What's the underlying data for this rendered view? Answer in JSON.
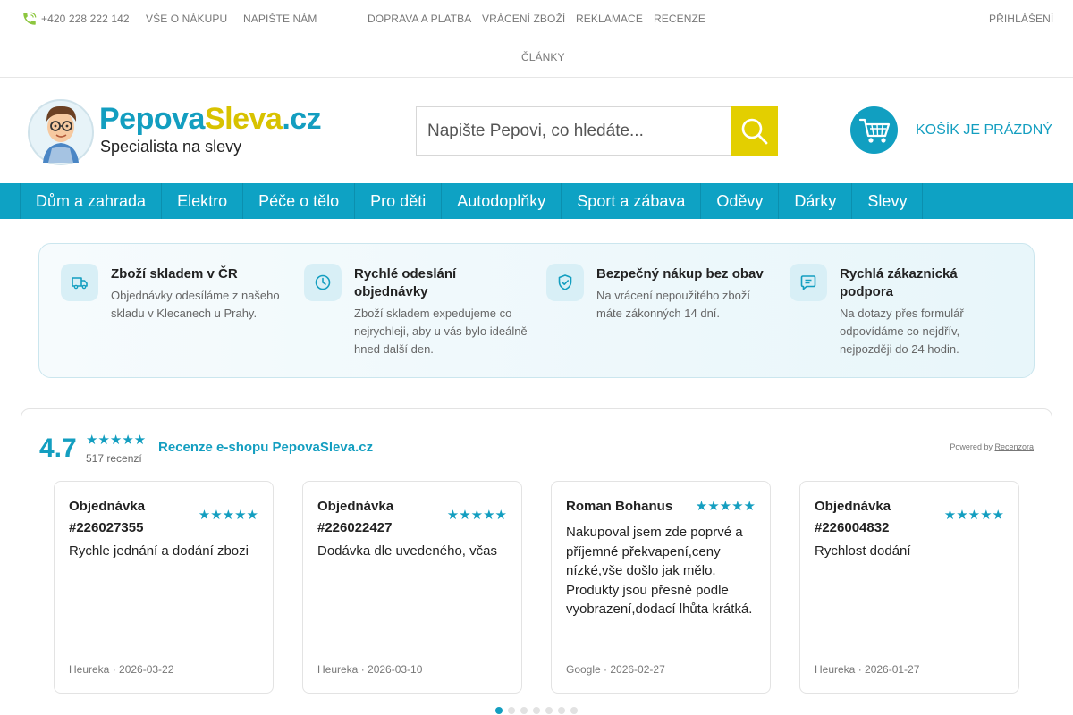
{
  "topbar": {
    "phone": "+420 228 222 142",
    "links": [
      "Vše o nákupu",
      "Napište nám",
      "Doprava a platba",
      "Vrácení zboží",
      "Reklamace",
      "Recenze",
      "Články"
    ],
    "login": "Přihlášení"
  },
  "header": {
    "logo_word1": "Pepova",
    "logo_word2": "Sleva",
    "logo_word3": ".cz",
    "logo_tagline": "Specialista na slevy",
    "search_placeholder": "Napište Pepovi, co hledáte...",
    "cart_label": "KOŠÍK JE PRÁZDNÝ"
  },
  "nav": {
    "items": [
      "Dům a zahrada",
      "Elektro",
      "Péče o tělo",
      "Pro děti",
      "Autodoplňky",
      "Sport a zábava",
      "Oděvy",
      "Dárky",
      "Slevy"
    ]
  },
  "benefits": [
    {
      "icon": "truck-icon",
      "title": "Zboží skladem v ČR",
      "text": "Objednávky odesíláme z našeho skladu v Klecanech u Prahy."
    },
    {
      "icon": "clock-icon",
      "title": "Rychlé odeslání objednávky",
      "text": "Zboží skladem expedujeme co nejrychleji, aby u vás bylo ideálně hned další den."
    },
    {
      "icon": "shield-check-icon",
      "title": "Bezpečný nákup bez obav",
      "text": "Na vrácení nepoužitého zboží máte zákonných 14 dní."
    },
    {
      "icon": "chat-icon",
      "title": "Rychlá zákaznická podpora",
      "text": "Na dotazy přes formulář odpovídáme co nejdřív, nejpozději do 24 hodin."
    }
  ],
  "reviews": {
    "rating": "4.7",
    "stars": "★★★★★",
    "count": "517 recenzí",
    "title": "Recenze e-shopu PepovaSleva.cz",
    "powered_by": "Powered by",
    "powered_link": "Recenzora",
    "items": [
      {
        "author": "Objednávka #226027355",
        "stars": "★★★★★",
        "text": "Rychle jednání a dodání zbozi",
        "source": "Heureka · 2026-03-22"
      },
      {
        "author": "Objednávka #226022427",
        "stars": "★★★★★",
        "text": "Dodávka dle uvedeného, včas",
        "source": "Heureka · 2026-03-10"
      },
      {
        "author": "Roman Bohanus",
        "stars": "★★★★★",
        "text": "Nakupoval jsem zde poprvé a příjemné překvapení,ceny nízké,vše došlo jak mělo. Produkty jsou přesně podle vyobrazení,dodací lhůta krátká.",
        "source": "Google · 2026-02-27"
      },
      {
        "author": "Objednávka #226004832",
        "stars": "★★★★★",
        "text": "Rychlost dodání",
        "source": "Heureka · 2026-01-27"
      }
    ],
    "pagination_count": 7,
    "pagination_active": 1
  },
  "colors": {
    "brand_blue": "#139ec0",
    "brand_yellow": "#e3cf00",
    "nav_bg": "#0ea2c4"
  }
}
